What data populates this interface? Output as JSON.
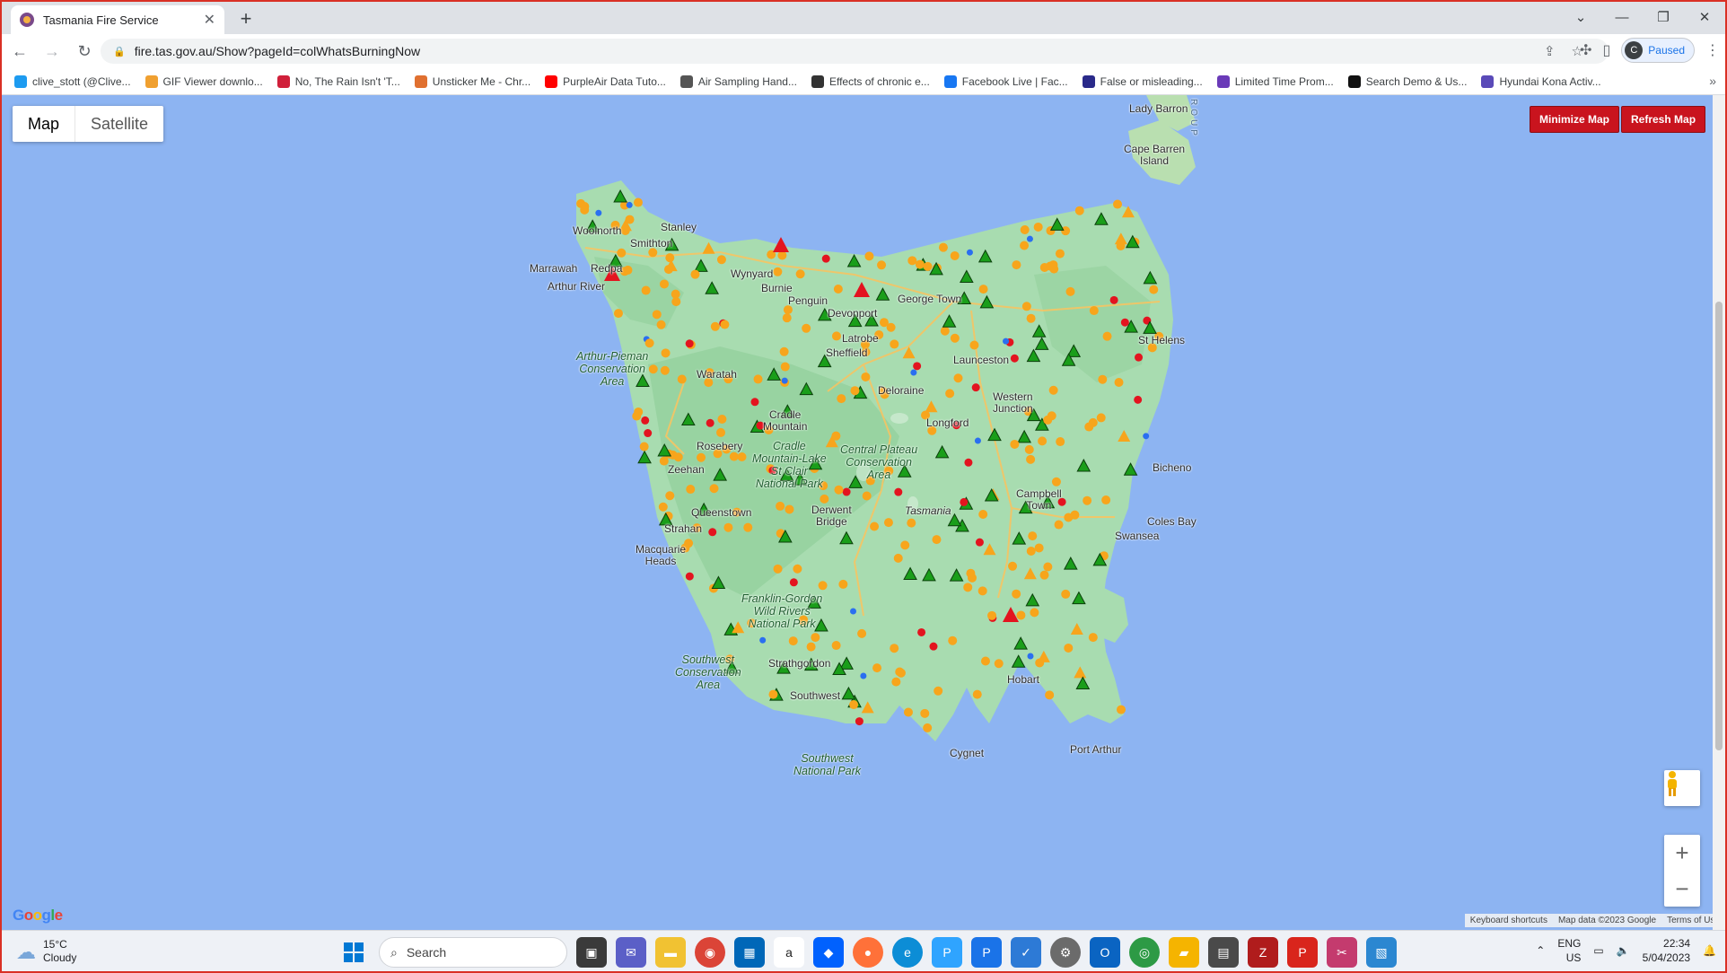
{
  "browser": {
    "tab_title": "Tasmania Fire Service",
    "tab_close": "✕",
    "new_tab": "+",
    "url": "fire.tas.gov.au/Show?pageId=colWhatsBurningNow",
    "profile_initial": "C",
    "profile_status": "Paused",
    "bookmarks": [
      {
        "label": "clive_stott (@Clive...",
        "color": "#1d9bf0"
      },
      {
        "label": "GIF Viewer downlo...",
        "color": "#f0a030"
      },
      {
        "label": "No, The Rain Isn't 'T...",
        "color": "#d0203a"
      },
      {
        "label": "Unsticker Me - Chr...",
        "color": "#e07030"
      },
      {
        "label": "PurpleAir Data Tuto...",
        "color": "#ff0000"
      },
      {
        "label": "Air Sampling Hand...",
        "color": "#555555"
      },
      {
        "label": "Effects of chronic e...",
        "color": "#333333"
      },
      {
        "label": "Facebook Live | Fac...",
        "color": "#1877f2"
      },
      {
        "label": "False or misleading...",
        "color": "#2a2a8a"
      },
      {
        "label": "Limited Time Prom...",
        "color": "#6a3ab8"
      },
      {
        "label": "Search Demo & Us...",
        "color": "#111111"
      },
      {
        "label": "Hyundai Kona Activ...",
        "color": "#5a4ab8"
      }
    ]
  },
  "map": {
    "type_map": "Map",
    "type_satellite": "Satellite",
    "minimize_label": "Minimize Map",
    "refresh_label": "Refresh Map",
    "zoom_in": "+",
    "zoom_out": "−",
    "logo": "Google",
    "attribution": [
      "Keyboard shortcuts",
      "Map data ©2023 Google",
      "Terms of Use"
    ],
    "labels": {
      "lady_barron": "Lady Barron",
      "cape_barren": "Cape Barren\nIsland",
      "woolnorth": "Woolnorth",
      "stanley": "Stanley",
      "smithton": "Smithton",
      "marrawah": "Marrawah",
      "redpa": "Redpa",
      "arthur_river": "Arthur River",
      "wynyard": "Wynyard",
      "burnie": "Burnie",
      "penguin": "Penguin",
      "devonport": "Devonport",
      "george_town": "George Town",
      "latrobe": "Latrobe",
      "sheffield": "Sheffield",
      "launceston": "Launceston",
      "st_helens": "St Helens",
      "arthur_pieman": "Arthur-Pieman\nConservation\nArea",
      "waratah": "Waratah",
      "deloraine": "Deloraine",
      "western_junction": "Western\nJunction",
      "cradle_mountain": "Cradle\nMountain",
      "longford": "Longford",
      "rosebery": "Rosebery",
      "cradle_lake": "Cradle\nMountain-Lake\nSt Clair\nNational Park",
      "central_plateau": "Central Plateau\nConservation\nArea",
      "zeehan": "Zeehan",
      "bicheno": "Bicheno",
      "campbell_town": "Campbell\nTown",
      "queenstown": "Queenstown",
      "tasmania": "Tasmania",
      "derwent_bridge": "Derwent\nBridge",
      "coles_bay": "Coles Bay",
      "strahan": "Strahan",
      "swansea": "Swansea",
      "macquarie_heads": "Macquarie\nHeads",
      "franklin_gordon": "Franklin-Gordon\nWild Rivers\nNational Park",
      "southwest_ca": "Southwest\nConservation\nArea",
      "strathgordon": "Strathgordon",
      "southwest": "Southwest",
      "port_arthur": "Port Arthur",
      "cygnet": "Cygnet",
      "southwest_np": "Southwest\nNational Park",
      "hobart": "Hobart",
      "roup": "ROUP"
    }
  },
  "taskbar": {
    "temp": "15°C",
    "condition": "Cloudy",
    "search": "Search",
    "lang1": "ENG",
    "lang2": "US",
    "time": "22:34",
    "date": "5/04/2023"
  }
}
